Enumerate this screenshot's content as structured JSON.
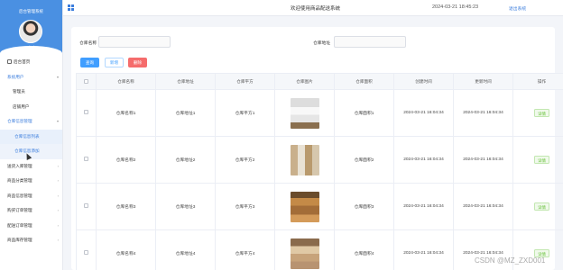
{
  "sidebar": {
    "system_title": "后台管理系统",
    "username": "admin",
    "items": [
      {
        "label": "后台首页"
      },
      {
        "label": "系统用户"
      },
      {
        "label": "管理员"
      },
      {
        "label": "店铺用户"
      },
      {
        "label": "仓库信息管理"
      },
      {
        "label": "仓库信息列表"
      },
      {
        "label": "仓库信息添加"
      },
      {
        "label": "送货入库管理"
      },
      {
        "label": "商品分类管理"
      },
      {
        "label": "商品信息管理"
      },
      {
        "label": "购买订单管理"
      },
      {
        "label": "配送订单管理"
      },
      {
        "label": "商品库存管理"
      }
    ]
  },
  "topbar": {
    "welcome": "欢迎使用商品配送系统",
    "datetime": "2024-03-21 18:45:23",
    "logout": "退出系统"
  },
  "search": {
    "name_label": "仓库名称",
    "name_value": "",
    "address_label": "仓库地址",
    "address_value": ""
  },
  "buttons": {
    "query": "查询",
    "add": "新增",
    "delete": "删除"
  },
  "table": {
    "headers": [
      "仓库名称",
      "仓库地址",
      "仓库平方",
      "仓库图片",
      "仓库面积",
      "创建时间",
      "更新时间",
      "操作"
    ],
    "rows": [
      {
        "name": "仓库名称1",
        "address": "仓库地址1",
        "sqm": "仓库平方1",
        "area": "仓库面积1",
        "created": "2024-03-21 16:04:34",
        "updated": "2024-03-21 16:04:34",
        "action": "详情"
      },
      {
        "name": "仓库名称2",
        "address": "仓库地址2",
        "sqm": "仓库平方2",
        "area": "仓库面积2",
        "created": "2024-03-21 16:04:34",
        "updated": "2024-03-21 16:04:34",
        "action": "详情"
      },
      {
        "name": "仓库名称3",
        "address": "仓库地址3",
        "sqm": "仓库平方3",
        "area": "仓库面积3",
        "created": "2024-03-21 16:04:34",
        "updated": "2024-03-21 16:04:34",
        "action": "详情"
      },
      {
        "name": "仓库名称4",
        "address": "仓库地址4",
        "sqm": "仓库平方4",
        "area": "仓库面积4",
        "created": "2024-03-21 16:04:34",
        "updated": "2024-03-21 16:04:34",
        "action": "详情"
      }
    ]
  },
  "watermark": "CSDN @MZ_ZXD001"
}
